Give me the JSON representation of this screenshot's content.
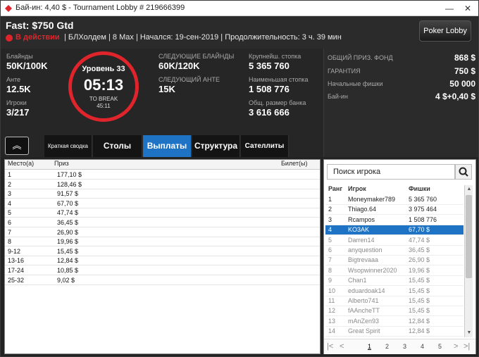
{
  "window": {
    "title": "Бай-ин: 4,40 $ - Tournament Lobby # 219666399",
    "minimize": "—",
    "close": "✕"
  },
  "header": {
    "tournament_name": "Fast: $750 Gtd",
    "status": "В действии",
    "info": "| БЛХолдем | 8 Max | Начался: 19-сен-2019 | Продолжительность: 3 ч. 39 мин",
    "lobby_button": "Poker Lobby"
  },
  "stats": {
    "blinds_label": "Блайнды",
    "blinds": "50K/100K",
    "ante_label": "Анте",
    "ante": "12.5K",
    "players_label": "Игроки",
    "players": "3/217",
    "level": "Уровень 33",
    "clock": "05:13",
    "to_break_label": "TO BREAK",
    "to_break": "45:11",
    "next_blinds_label": "СЛЕДУЮЩИЕ БЛАЙНДЫ",
    "next_blinds": "60K/120K",
    "next_ante_label": "СЛЕДУЮЩИЙ АНТЕ",
    "next_ante": "15K",
    "largest_stack_label": "Крупнейш. стопка",
    "largest_stack": "5 365 760",
    "smallest_stack_label": "Наименьшая стопка",
    "smallest_stack": "1 508 776",
    "bank_label": "Общ. размер банка",
    "bank": "3 616 666"
  },
  "prize": {
    "pool_label": "ОБЩИЙ ПРИЗ. ФОНД",
    "pool": "868 $",
    "guarantee_label": "ГАРАНТИЯ",
    "guarantee": "750 $",
    "chips_label": "Начальные фишки",
    "chips": "50 000",
    "buyin_label": "Бай-ин",
    "buyin": "4 $+0,40 $"
  },
  "tabs": {
    "collapse": "︽",
    "summary": "Краткая сводка",
    "tables": "Столы",
    "payouts": "Выплаты",
    "structure": "Структура",
    "satellites": "Сателлиты"
  },
  "payouts": {
    "headers": {
      "place": "Место(а)",
      "prize": "Приз",
      "ticket": "Билет(ы)"
    },
    "rows": [
      {
        "place": "1",
        "prize": "177,10 $"
      },
      {
        "place": "2",
        "prize": "128,46 $"
      },
      {
        "place": "3",
        "prize": "91,57 $"
      },
      {
        "place": "4",
        "prize": "67,70 $"
      },
      {
        "place": "5",
        "prize": "47,74 $"
      },
      {
        "place": "6",
        "prize": "36,45 $"
      },
      {
        "place": "7",
        "prize": "26,90 $"
      },
      {
        "place": "8",
        "prize": "19,96 $"
      },
      {
        "place": "9-12",
        "prize": "15,45 $"
      },
      {
        "place": "13-16",
        "prize": "12,84 $"
      },
      {
        "place": "17-24",
        "prize": "10,85 $"
      },
      {
        "place": "25-32",
        "prize": "9,02 $"
      }
    ]
  },
  "players": {
    "search_placeholder": "Поиск игрока",
    "headers": {
      "rank": "Ранг",
      "player": "Игрок",
      "chips": "Фишки"
    },
    "rows": [
      {
        "rank": "1",
        "player": "Moneymaker789",
        "chips": "5 365 760"
      },
      {
        "rank": "2",
        "player": "Thiago.64",
        "chips": "3 975 464"
      },
      {
        "rank": "3",
        "player": "Rcampos",
        "chips": "1 508 776"
      },
      {
        "rank": "4",
        "player": "KO3AK",
        "chips": "67,70 $"
      },
      {
        "rank": "5",
        "player": "Darren14",
        "chips": "47,74 $"
      },
      {
        "rank": "6",
        "player": "anyquestion",
        "chips": "36,45 $"
      },
      {
        "rank": "7",
        "player": "Bigtrevaaa",
        "chips": "26,90 $"
      },
      {
        "rank": "8",
        "player": "Wsopwinner2020",
        "chips": "19,96 $"
      },
      {
        "rank": "9",
        "player": "Chan1",
        "chips": "15,45 $"
      },
      {
        "rank": "10",
        "player": "eduardoak14",
        "chips": "15,45 $"
      },
      {
        "rank": "11",
        "player": "Alberto741",
        "chips": "15,45 $"
      },
      {
        "rank": "12",
        "player": "fAAncheTT",
        "chips": "15,45 $"
      },
      {
        "rank": "13",
        "player": "mAnZen93",
        "chips": "12,84 $"
      },
      {
        "rank": "14",
        "player": "Great Spirit",
        "chips": "12,84 $"
      }
    ],
    "selected_rank": "4",
    "pages": [
      "1",
      "2",
      "3",
      "4",
      "5"
    ],
    "current_page": "1"
  },
  "colors": {
    "accent": "#1f73c4",
    "status": "#e0242b",
    "background": "#232323"
  }
}
